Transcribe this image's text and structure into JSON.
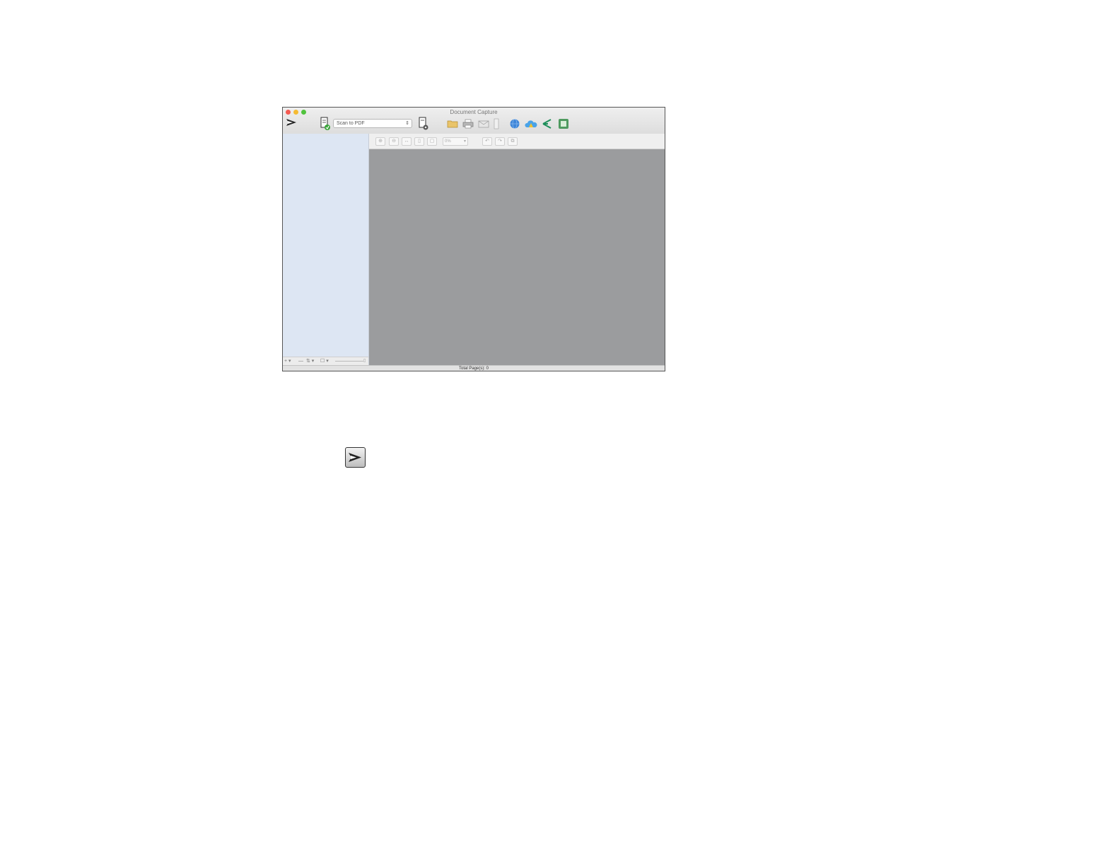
{
  "window": {
    "title": "Document Capture"
  },
  "toolbar": {
    "app_logo_icon": "document-capture-logo-icon",
    "scan_button_icon": "scan-document-icon",
    "job_select_value": "Scan to PDF",
    "settings_button_icon": "scan-settings-icon",
    "destinations": [
      {
        "name": "save-to-folder",
        "icon": "folder-icon"
      },
      {
        "name": "print",
        "icon": "printer-icon"
      },
      {
        "name": "email",
        "icon": "envelope-icon"
      },
      {
        "name": "send-to-application",
        "icon": "document-icon"
      },
      {
        "name": "web-folder",
        "icon": "globe-icon"
      },
      {
        "name": "cloud",
        "icon": "cloud-drive-icon"
      },
      {
        "name": "sharepoint",
        "icon": "share-icon"
      },
      {
        "name": "evernote",
        "icon": "green-app-icon"
      }
    ]
  },
  "view_toolbar": {
    "zoom_value": "0%",
    "buttons": [
      {
        "name": "zoom-in",
        "icon": "zoom-in-icon"
      },
      {
        "name": "zoom-out",
        "icon": "zoom-out-icon"
      },
      {
        "name": "fit-width",
        "icon": "fit-width-icon"
      },
      {
        "name": "fit-page",
        "icon": "fit-page-icon"
      },
      {
        "name": "actual-size",
        "icon": "actual-size-icon"
      },
      {
        "name": "rotate-left",
        "icon": "rotate-left-icon"
      },
      {
        "name": "rotate-right",
        "icon": "rotate-right-icon"
      },
      {
        "name": "copy",
        "icon": "copy-icon"
      }
    ]
  },
  "sidebar_bottom": {
    "add_label": "+ ▾",
    "remove_label": "—",
    "sort_label": "⇅ ▾",
    "view_label": "☐ ▾"
  },
  "status": {
    "total_pages": "Total Page(s): 0"
  },
  "colors": {
    "sidebar_bg": "#dde6f3",
    "preview_bg": "#9b9c9e"
  }
}
